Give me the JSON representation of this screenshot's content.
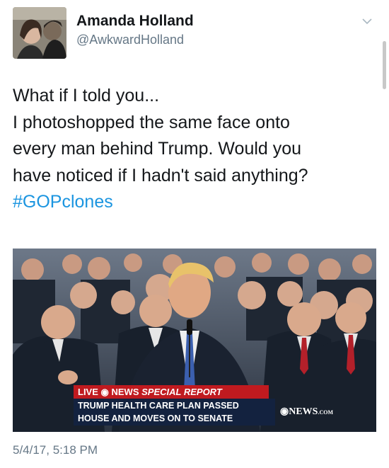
{
  "user": {
    "display_name": "Amanda Holland",
    "handle": "@AwkwardHolland",
    "avatar_icon": "avatar-photo"
  },
  "tweet": {
    "lines": [
      "What if I told you...",
      "I photoshopped the same face onto",
      "every man behind Trump. Would you",
      "have noticed if I hadn't said anything?"
    ],
    "hashtag": "#GOPclones",
    "timestamp": "5/4/17, 5:18 PM"
  },
  "media": {
    "banner_live": "LIVE",
    "banner_network": "NEWS",
    "banner_special": "SPECIAL REPORT",
    "headline_line1": "TRUMP HEALTH CARE PLAN PASSED",
    "headline_line2": "HOUSE AND MOVES ON TO SENATE",
    "logo_text": "NEWS",
    "logo_suffix": ".COM"
  },
  "colors": {
    "hashtag": "#1b95e0",
    "muted": "#657786",
    "banner_red": "#c01a1f",
    "banner_navy": "#13223f"
  }
}
